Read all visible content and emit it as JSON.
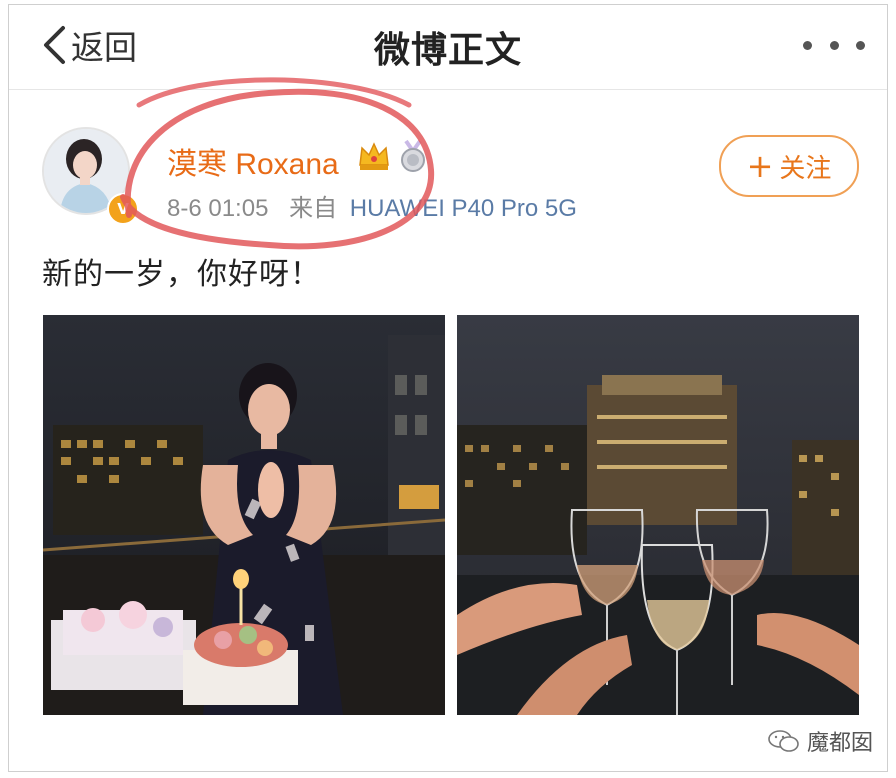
{
  "header": {
    "back_label": "返回",
    "title": "微博正文"
  },
  "user": {
    "name": "漠寒 Roxana",
    "verified_badge": "V",
    "timestamp": "8-6 01:05",
    "source_prefix": "来自",
    "device": "HUAWEI P40 Pro 5G"
  },
  "follow_button": {
    "plus": "+",
    "label": "关注"
  },
  "post": {
    "text": "新的一岁，你好呀！"
  },
  "watermark": {
    "label": "魔都囡"
  },
  "colors": {
    "username": "#e86b17",
    "follow_border": "#f0a055",
    "device_link": "#5a7ba6",
    "annotation_circle": "#e2585b"
  },
  "icons": {
    "back": "chevron-left-icon",
    "more": "more-dots-icon",
    "crown": "crown-icon",
    "medal": "medal-icon",
    "wechat": "wechat-icon"
  }
}
